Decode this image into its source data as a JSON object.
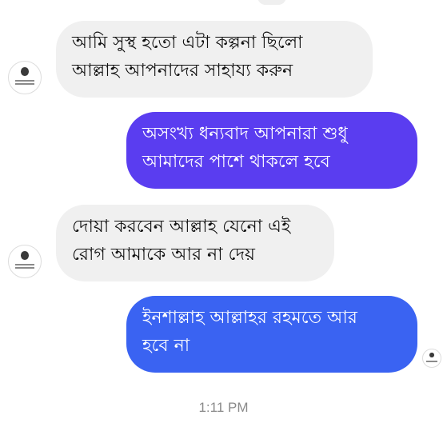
{
  "colors": {
    "incoming_bubble": "#f0f0f0",
    "outgoing_bubble_top": "#5a3df0",
    "outgoing_bubble_bottom": "#3a63f2",
    "timestamp_text": "#8a8a8a"
  },
  "messages": [
    {
      "direction": "incoming",
      "lines": [
        "আমি সুস্থ হতো এটা কল্পনা ছিলো",
        "আল্লাহ আপনাদের সাহায্য করুন"
      ],
      "show_avatar": true,
      "color": "#f0f0f0"
    },
    {
      "direction": "outgoing",
      "lines": [
        "অসংখ্য ধন্যবাদ আপনারা শুধু",
        "আমাদের পাশে থাকলে হবে"
      ],
      "show_avatar": false,
      "color": "#5a3df0"
    },
    {
      "direction": "incoming",
      "lines": [
        "দোয়া করবেন আল্লাহ যেনো এই",
        "রোগ আমাকে আর না দেয়"
      ],
      "show_avatar": true,
      "color": "#f0f0f0"
    },
    {
      "direction": "outgoing",
      "lines": [
        "ইনশাল্লাহ আল্লাহর রহমতে আর",
        "হবে না"
      ],
      "show_avatar": true,
      "color": "#3a63f2"
    }
  ],
  "timestamp": "1:11 PM"
}
